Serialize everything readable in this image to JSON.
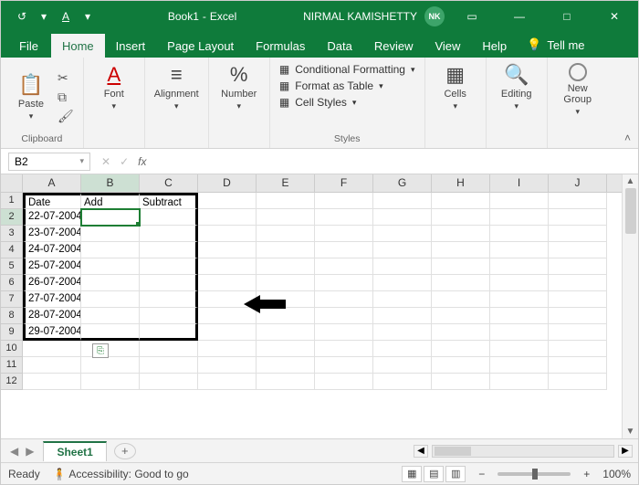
{
  "title": {
    "autosave_icon": "↺",
    "doc_name": "Book1",
    "app_name": "Excel",
    "user_name": "NIRMAL KAMISHETTY",
    "user_initials": "NK"
  },
  "tabs": {
    "file": "File",
    "home": "Home",
    "insert": "Insert",
    "pagelayout": "Page Layout",
    "formulas": "Formulas",
    "data": "Data",
    "review": "Review",
    "view": "View",
    "help": "Help",
    "tellme": "Tell me"
  },
  "ribbon": {
    "clipboard": {
      "paste": "Paste",
      "label": "Clipboard"
    },
    "font": {
      "btn": "Font",
      "label": ""
    },
    "alignment": {
      "btn": "Alignment",
      "label": ""
    },
    "number": {
      "btn": "Number",
      "label": ""
    },
    "styles": {
      "cf": "Conditional Formatting",
      "ft": "Format as Table",
      "cs": "Cell Styles",
      "label": "Styles"
    },
    "cells": {
      "btn": "Cells",
      "label": ""
    },
    "editing": {
      "btn": "Editing",
      "label": ""
    },
    "newgroup": {
      "btn": "New\nGroup",
      "label": ""
    }
  },
  "namebox": "B2",
  "formula": "",
  "columns": [
    "A",
    "B",
    "C",
    "D",
    "E",
    "F",
    "G",
    "H",
    "I",
    "J"
  ],
  "rows": [
    "1",
    "2",
    "3",
    "4",
    "5",
    "6",
    "7",
    "8",
    "9",
    "10",
    "11",
    "12"
  ],
  "grid": {
    "r1": {
      "A": "Date",
      "B": "Add",
      "C": "Subtract"
    },
    "r2": {
      "A": "22-07-2004"
    },
    "r3": {
      "A": "23-07-2004"
    },
    "r4": {
      "A": "24-07-2004"
    },
    "r5": {
      "A": "25-07-2004"
    },
    "r6": {
      "A": "26-07-2004"
    },
    "r7": {
      "A": "27-07-2004"
    },
    "r8": {
      "A": "28-07-2004"
    },
    "r9": {
      "A": "29-07-2004"
    }
  },
  "sheet_tab": "Sheet1",
  "status": {
    "ready": "Ready",
    "accessibility": "Accessibility: Good to go",
    "zoom": "100%"
  }
}
